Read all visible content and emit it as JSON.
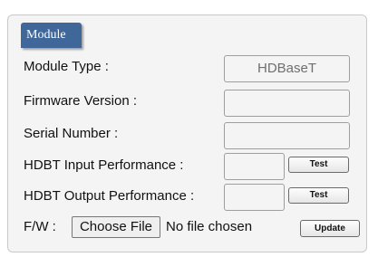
{
  "panel": {
    "title": "Module"
  },
  "rows": {
    "module_type": {
      "label": "Module Type :",
      "value": "HDBaseT"
    },
    "firmware_version": {
      "label": "Firmware Version :",
      "value": ""
    },
    "serial_number": {
      "label": "Serial Number :",
      "value": ""
    },
    "hdbt_input": {
      "label": "HDBT Input Performance :",
      "value": "",
      "button": "Test"
    },
    "hdbt_output": {
      "label": "HDBT Output Performance :",
      "value": "",
      "button": "Test"
    },
    "fw": {
      "label": "F/W :",
      "choose_label": "Choose File",
      "status": "No file chosen",
      "update_label": "Update"
    }
  }
}
